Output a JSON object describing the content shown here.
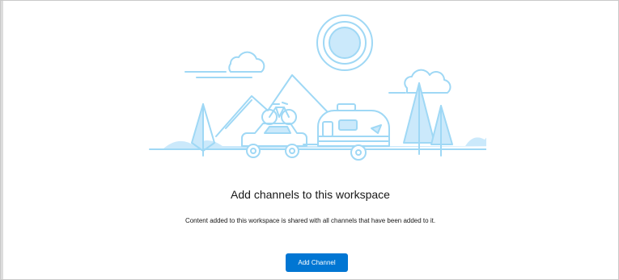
{
  "empty_state": {
    "heading": "Add channels to this workspace",
    "description": "Content added to this workspace is shared with all channels that have been added to it.",
    "primary_action_label": "Add Channel",
    "illustration": "camping-trailer-illustration"
  },
  "colors": {
    "accent": "#0176d3",
    "illustration_stroke": "#9fd8f5",
    "illustration_fill": "#cbe9fb"
  }
}
